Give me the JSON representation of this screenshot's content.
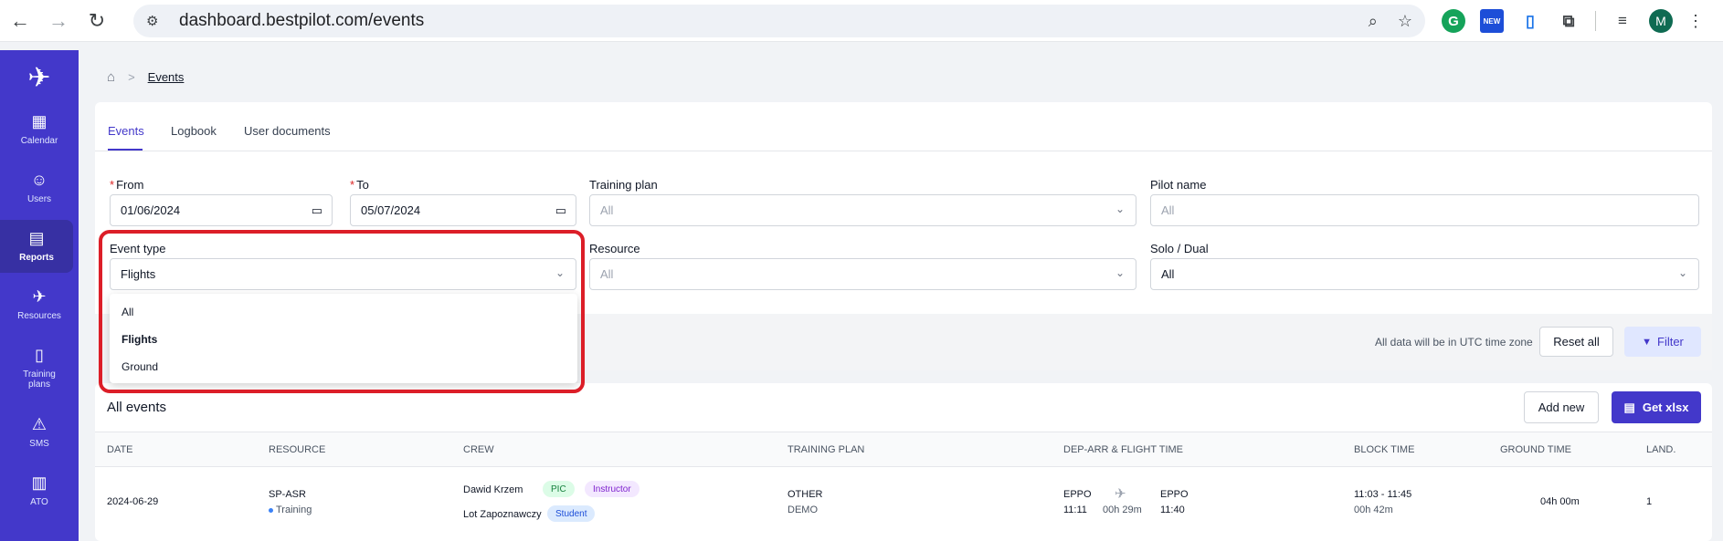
{
  "browser": {
    "url": "dashboard.bestpilot.com/events",
    "back_icon": "←",
    "forward_icon": "→",
    "reload_icon": "↻",
    "tune_icon": "⚙",
    "zoom_icon": "⌕",
    "star_icon": "☆",
    "ext_g": "G",
    "ext_new": "NEW",
    "ext_doc": "▯",
    "ext_puzzle": "⧉",
    "ext_media": "≡",
    "avatar_letter": "M",
    "menu_icon": "⋮"
  },
  "sidebar": {
    "logo": "✈",
    "items": [
      {
        "label": "Calendar",
        "icon": "▦"
      },
      {
        "label": "Users",
        "icon": "☺"
      },
      {
        "label": "Reports",
        "icon": "▤"
      },
      {
        "label": "Resources",
        "icon": "✈"
      },
      {
        "label": "Training plans",
        "icon": "▯"
      },
      {
        "label": "SMS",
        "icon": "⚠"
      },
      {
        "label": "ATO",
        "icon": "▥"
      }
    ]
  },
  "breadcrumb": {
    "home_icon": "⌂",
    "separator": ">",
    "current": "Events"
  },
  "tabs": [
    {
      "label": "Events"
    },
    {
      "label": "Logbook"
    },
    {
      "label": "User documents"
    }
  ],
  "form": {
    "required_mark": "*",
    "from": {
      "label": "From",
      "value": "01/06/2024",
      "icon": "▭"
    },
    "to": {
      "label": "To",
      "value": "05/07/2024",
      "icon": "▭"
    },
    "training_plan": {
      "label": "Training plan",
      "placeholder": "All"
    },
    "pilot_name": {
      "label": "Pilot name",
      "placeholder": "All"
    },
    "event_type": {
      "label": "Event type",
      "value": "Flights"
    },
    "resource": {
      "label": "Resource",
      "placeholder": "All"
    },
    "solo_dual": {
      "label": "Solo / Dual",
      "value": "All"
    },
    "chevron": "⌄"
  },
  "dropdown": {
    "options": [
      "All",
      "Flights",
      "Ground"
    ],
    "selected": "Flights"
  },
  "filter_bar": {
    "utc_note": "All data will be in UTC time zone",
    "reset_label": "Reset all",
    "filter_label": "Filter",
    "filter_icon": "▼"
  },
  "events": {
    "title": "All events",
    "add_label": "Add new",
    "xlsx_label": "Get xlsx",
    "xlsx_icon": "▤",
    "columns": [
      "DATE",
      "RESOURCE",
      "CREW",
      "TRAINING PLAN",
      "DEP-ARR & FLIGHT TIME",
      "BLOCK TIME",
      "GROUND TIME",
      "LAND."
    ],
    "rows": [
      {
        "date": "2024-06-29",
        "resource": "SP-ASR",
        "resource_type": "Training",
        "crew": [
          {
            "name": "Dawid Krzem",
            "badges": [
              "PIC",
              "Instructor"
            ]
          },
          {
            "name": "Lot Zapoznawczy",
            "badges": [
              "Student"
            ]
          }
        ],
        "training_plan": "OTHER",
        "training_sub": "DEMO",
        "dep": "EPPO",
        "dep_time": "11:11",
        "flight_time": "00h 29m",
        "arr": "EPPO",
        "arr_time": "11:40",
        "plane_icon": "✈",
        "block_time": "11:03 - 11:45",
        "block_duration": "00h 42m",
        "ground_time": "04h 00m",
        "landings": "1"
      }
    ]
  },
  "colors": {
    "primary": "#4338ca",
    "highlight": "#dc1e28"
  }
}
